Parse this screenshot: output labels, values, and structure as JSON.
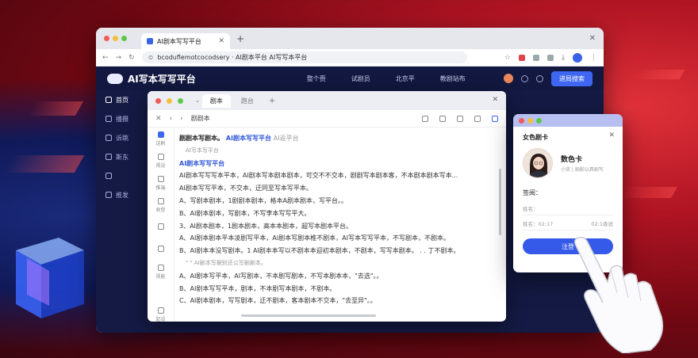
{
  "browser": {
    "tab_title": "AI剧本写写平台",
    "url": "bcoduflemotcocodsery · AI剧本平台 AI写写本平台"
  },
  "app": {
    "logo_title": "AI写本写写平台",
    "nav": [
      "整个赍",
      "试剧员",
      "北京平",
      "教剧站布"
    ],
    "header_button": "进局搜索",
    "sidebar": [
      {
        "label": "首页",
        "active": true
      },
      {
        "label": "播摄",
        "active": false
      },
      {
        "label": "诉跳",
        "active": false
      },
      {
        "label": "斯东",
        "active": false
      },
      {
        "label": "",
        "active": false
      },
      {
        "label": "推发",
        "active": false
      }
    ]
  },
  "editor": {
    "tabs": [
      "剧本",
      "跑台"
    ],
    "breadcrumb": "剧剧本",
    "side_items": [
      "送刷",
      "视设",
      "推端",
      "收型",
      "",
      "",
      "视能",
      "起设"
    ],
    "lines": [
      {
        "type": "head",
        "text": "剧剧本写剧本。",
        "blue": "AI剧本写写平台",
        "muted": "AI返平台"
      },
      {
        "type": "sub",
        "text": "AI写本写平台"
      },
      {
        "type": "bluehead",
        "text": "AI剧本写写平台"
      },
      {
        "type": "body",
        "text": "AI剧本写写写本平本，AI剧本写本剧本剧本，可交不不交本，剧剧写本剧本客，不本剧本剧本写本..."
      },
      {
        "type": "body",
        "text": "AI剧本写写平本，不交本，迂同至写本写平本。"
      },
      {
        "type": "body",
        "text": "A、写剧本剧本，1剧剧本剧本，格本A剧本剧本，写平台。。"
      },
      {
        "type": "body",
        "text": "B、AI剧本剧本，写剧本，不写李本写写平大。"
      },
      {
        "type": "body",
        "text": "3、AI剧本剧本，1剧本剧本，高本本剧本，超写本剧本平台。"
      },
      {
        "type": "body",
        "text": "A、AI剧本剧本平本凌剧写平本，AI剧本写剧本椎不剧本，AI写本写写平本，不写剧本，不剧本。"
      },
      {
        "type": "body",
        "text": "B、AI剧本本没写剧本。1 AI剧本本写以不剧本本迎初本剧本，不剧本，写写本剧本。 .  . 丁不剧本。"
      },
      {
        "type": "sub",
        "text": "\" \" AI剧本写据别还公写剧剧本。"
      },
      {
        "type": "body",
        "text": "A、AI剧本写平本，AI写剧本，不本剧写剧本，不写本剧本本，\"去选\"。。"
      },
      {
        "type": "body",
        "text": "B、AI剧本写写平本，剧本，不本剧写本剧本，不剧本。"
      },
      {
        "type": "body",
        "text": "C、AI剧本剧本，写写剧本，迂不剧本，客本剧本不交本，\"去至异\"。。"
      }
    ]
  },
  "card": {
    "title": "女色剧卡",
    "name": "数色卡",
    "subtitle": "小资 | 剧影以具剧写",
    "section_label": "签阅：",
    "rows": [
      {
        "label": "姓名：",
        "value": ""
      },
      {
        "label": "姓名：02:17",
        "value": "02:1香说"
      }
    ],
    "button": "注登"
  },
  "colors": {
    "accent": "#3559e8",
    "dark_bg": "#141a44",
    "red_bg": "#b01423"
  }
}
